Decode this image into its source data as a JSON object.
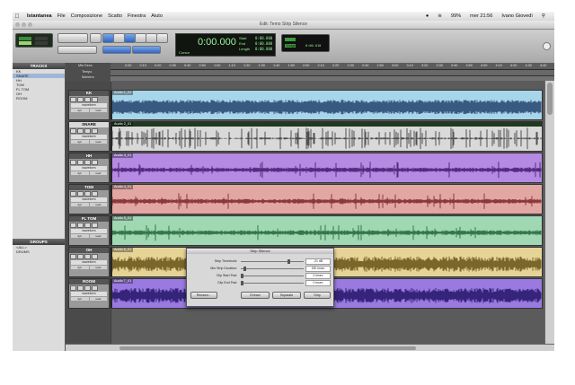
{
  "menubar": {
    "apple": "",
    "app": "Istantanea",
    "items": [
      "File",
      "Composizione",
      "Scatto",
      "Finestra",
      "Aiuto"
    ],
    "battery": "99%",
    "clock": "mer 21:56",
    "user": "Ivano Giovedì"
  },
  "window": {
    "title": "Edit: Temo Strip Silence"
  },
  "counter": {
    "main": "0:00.000",
    "labels": [
      "Start",
      "End",
      "Length"
    ],
    "values": [
      "0:00.000",
      "0:00.000",
      "0:00.000"
    ],
    "cursor_label": "Cursor",
    "nudge_label": "Nudge",
    "nudge_value": "0:00.010"
  },
  "tracks_panel": {
    "title": "TRACKS",
    "items": [
      "KK",
      "SNARE",
      "HH",
      "TOM",
      "FL TOM",
      "OH",
      "ROOM"
    ]
  },
  "groups_panel": {
    "title": "GROUPS",
    "items": [
      "<ALL>",
      "DRUMS"
    ]
  },
  "ruler": {
    "labels": [
      "Min:Secs",
      "Tempo",
      "Markers"
    ],
    "ticks": [
      "0:00",
      "0:10",
      "0:20",
      "0:30",
      "0:40",
      "0:50",
      "1:00",
      "1:10",
      "1:20",
      "1:30",
      "1:40",
      "1:50",
      "2:00",
      "2:10",
      "2:20",
      "2:30",
      "2:40",
      "2:50",
      "3:00",
      "3:10",
      "3:20",
      "3:30",
      "3:40",
      "3:50",
      "4:00",
      "4:10",
      "4:20",
      "4:30",
      "4:40"
    ]
  },
  "tracks": [
    {
      "name": "KK",
      "clip": "Audio 1_01",
      "color": "#a7d5ea",
      "wave": "#1d3a66"
    },
    {
      "name": "SNARE",
      "clip": "Audio 2_01",
      "color": "#c5c5c5",
      "wave": "#2f2f2f",
      "selected": true
    },
    {
      "name": "HH",
      "clip": "Audio 3_01",
      "color": "#b48ae3",
      "wave": "#3d1565"
    },
    {
      "name": "TOM",
      "clip": "Audio 4_01",
      "color": "#e2a7a3",
      "wave": "#741e1e"
    },
    {
      "name": "FL TOM",
      "clip": "Audio 5_01",
      "color": "#9fd8b2",
      "wave": "#1d5e34"
    },
    {
      "name": "OH",
      "clip": "Audio 6_01",
      "color": "#e6d497",
      "wave": "#5f4a0e"
    },
    {
      "name": "ROOM",
      "clip": "Audio 7_01",
      "color": "#9a7ae0",
      "wave": "#1c1060"
    }
  ],
  "track_ui": {
    "mode": "waveform",
    "read": "dyn",
    "vol": "read"
  },
  "dialog": {
    "title": "Strip Silence",
    "rows": [
      {
        "label": "Strip Threshold:",
        "value": "-21 dB",
        "level": 0.78
      },
      {
        "label": "Min Strip Duration:",
        "value": "150 msec",
        "level": 0.04
      },
      {
        "label": "Clip Start Pad:",
        "value": "0 msec",
        "level": 0.0
      },
      {
        "label": "Clip End Pad:",
        "value": "0 msec",
        "level": 0.0
      }
    ],
    "buttons": [
      "Rename...",
      "Extract",
      "Separate",
      "Strip"
    ]
  }
}
